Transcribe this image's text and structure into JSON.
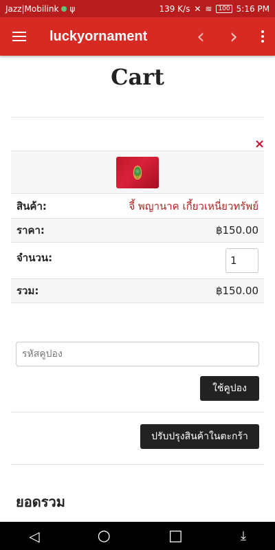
{
  "status_bar": {
    "carrier": "Jazz|Mobilink",
    "usb_icon": "ψ",
    "speed": "139 K/s",
    "battery": "100",
    "time": "5:16 PM"
  },
  "app_bar": {
    "title": "luckyornament",
    "menu_icon": "hamburger-icon",
    "back_icon": "‹",
    "forward_icon": "›"
  },
  "page": {
    "title": "Cart"
  },
  "cart": {
    "remove_symbol": "×",
    "product_label": "สินค้า:",
    "product_name": "จี้ พญานาค เกี้ยวเหนี่ยวทรัพย์",
    "price_label": "ราคา:",
    "price_value": "฿150.00",
    "quantity_label": "จำนวน:",
    "quantity_value": "1",
    "total_label": "รวม:",
    "total_value": "฿150.00"
  },
  "coupon": {
    "placeholder": "รหัสคูปอง",
    "apply_label": "ใช้คูปอง"
  },
  "update_cart_label": "ปรับปรุงสินค้าในตะกร้า",
  "totals_title": "ยอดรวม",
  "nav_bar": {
    "back": "◁",
    "home": "○",
    "recents": "□",
    "extra": "⤓"
  },
  "colors": {
    "app_bar": "#d72a22",
    "status_bar": "#b81d1d",
    "link": "#b22222",
    "button": "#222222"
  }
}
